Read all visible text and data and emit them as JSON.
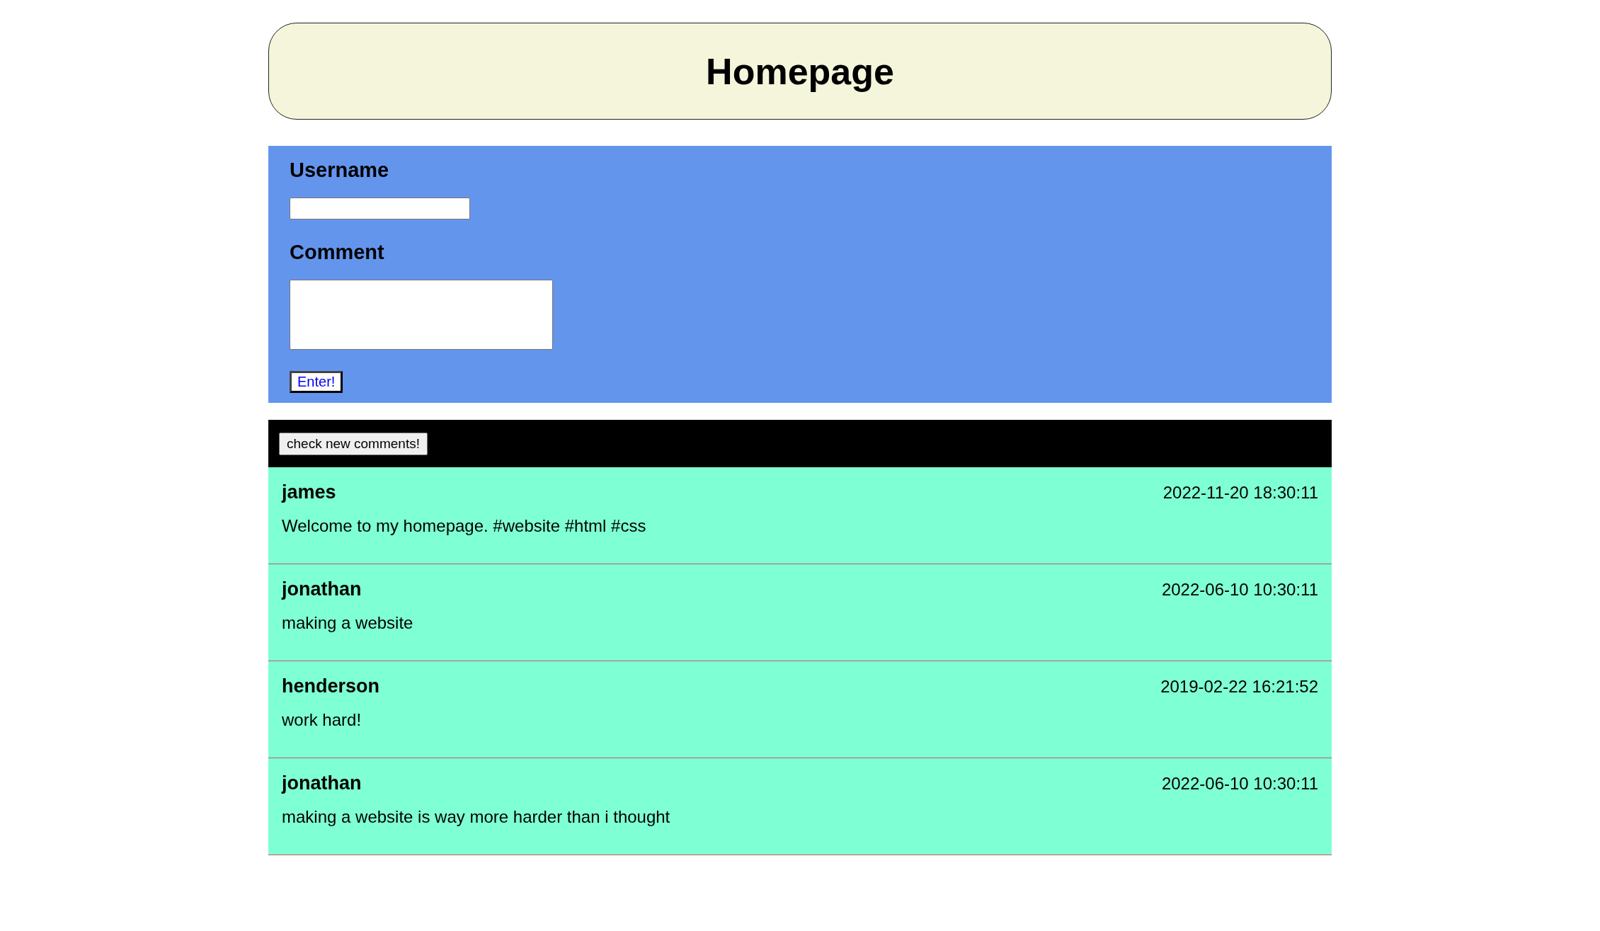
{
  "header": {
    "title": "Homepage"
  },
  "form": {
    "username_label": "Username",
    "comment_label": "Comment",
    "submit": "Enter!"
  },
  "toolbar": {
    "refresh_button": "check new comments!"
  },
  "comments": [
    {
      "author": "james",
      "time": "2022-11-20 18:30:11",
      "text": "Welcome to my homepage. #website #html #css"
    },
    {
      "author": "jonathan",
      "time": "2022-06-10 10:30:11",
      "text": "making a website"
    },
    {
      "author": "henderson",
      "time": "2019-02-22 16:21:52",
      "text": "work hard!"
    },
    {
      "author": "jonathan",
      "time": "2022-06-10 10:30:11",
      "text": "making a website is way more harder than i thought"
    }
  ]
}
